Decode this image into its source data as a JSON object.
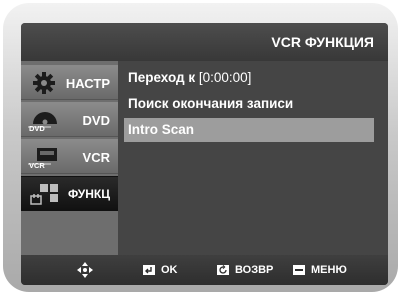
{
  "header": {
    "title": "VCR ФУНКЦИЯ"
  },
  "sidebar": {
    "items": [
      {
        "label": "НАСТР",
        "icon": "gear-icon"
      },
      {
        "label": "DVD",
        "icon": "dvd-disc-icon",
        "icon_text": "DVD"
      },
      {
        "label": "VCR",
        "icon": "vcr-tape-icon",
        "icon_text": "VCR"
      },
      {
        "label": "ФУНКЦ",
        "icon": "function-grid-icon",
        "active": true
      }
    ]
  },
  "menu": {
    "items": [
      {
        "label": "Переход к",
        "value": "[0:00:00]"
      },
      {
        "label": "Поиск окончания записи"
      },
      {
        "label": "Intro Scan",
        "selected": true
      }
    ]
  },
  "footer": {
    "nav_icon": "dpad-icon",
    "ok_label": "OK",
    "back_label": "ВОЗВР",
    "menu_label": "МЕНЮ"
  },
  "colors": {
    "selection": "#9d9d9d",
    "sidebar_active": "#1a1a1a",
    "background": "#454545"
  }
}
